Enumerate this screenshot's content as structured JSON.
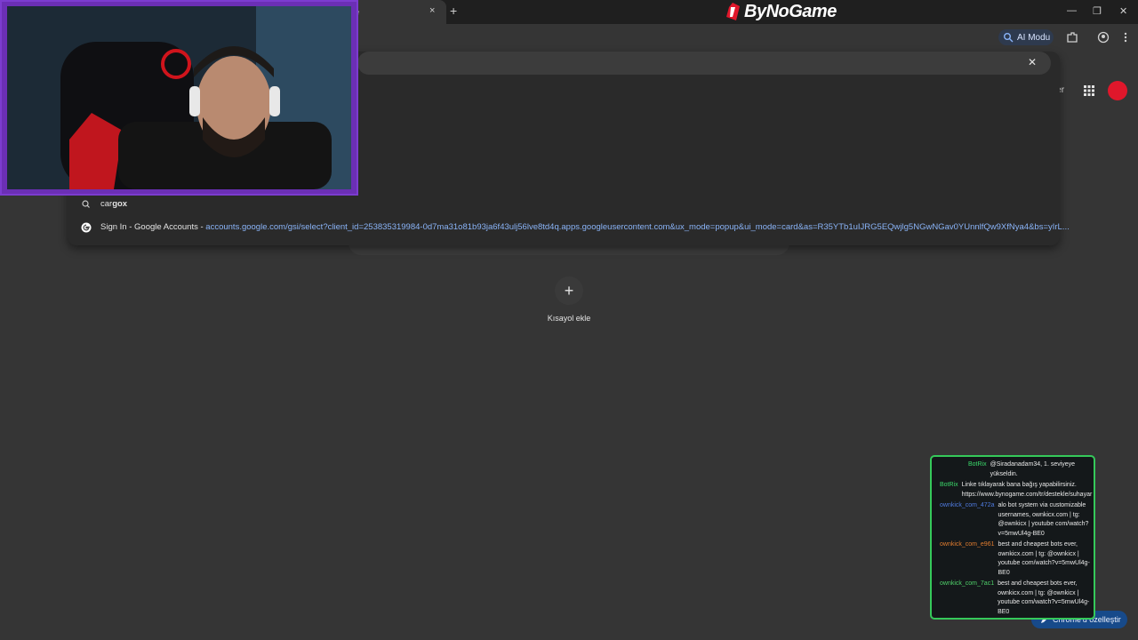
{
  "browser": {
    "tab_title": "e",
    "tab_close": "×",
    "new_tab": "+",
    "window_controls": {
      "minimize": "—",
      "maximize": "❐",
      "close": "✕"
    }
  },
  "overlay_brand": {
    "name": "ByNoGame",
    "color": "#e0172b"
  },
  "toolbar": {
    "ai_mode_label": "AI Modu",
    "ai_icon": "sparkle-search-icon"
  },
  "omnibox": {
    "clear": "✕",
    "suggestions": [
      {
        "icon": "search-icon",
        "prefix": "car",
        "bold": "gox",
        "text": "",
        "url": ""
      },
      {
        "icon": "google-icon",
        "prefix": "",
        "bold": "",
        "text": "Sign In - Google Accounts",
        "url": "accounts.google.com/gsi/select?client_id=253835319984-0d7ma31o81b93ja6f43ulj56lve8td4q.apps.googleusercontent.com&ux_mode=popup&ui_mode=card&as=R35YTb1uIJRG5EQwjlg5NGwNGav0YUnnlfQw9XfNya4&bs=yIrL..."
      }
    ]
  },
  "header_right": {
    "partial_label": "ler"
  },
  "ntp": {
    "shortcut_add_symbol": "+",
    "shortcut_add_label": "Kısayol ekle",
    "customize_label": "Chrome'u özelleştir"
  },
  "chat": {
    "messages": [
      {
        "user": "BotRix",
        "user_color": "#3bd96b",
        "text": "@Siradanadam34, 1. seviyeye yükseldin."
      },
      {
        "user": "BotRix",
        "user_color": "#3bd96b",
        "text": "Linke tıklayarak bana bağış yapabilirsiniz. https://www.bynogame.com/tr/destekle/suhayar"
      },
      {
        "user": "ownkick_com_472a",
        "user_color": "#4f7be0",
        "text": "alo bot system via customizable usernames, ownkicx.com | tg: @ownkicx | youtube com/watch?v=5mwUl4g-BE0"
      },
      {
        "user": "ownkick_com_e961",
        "user_color": "#e07c2f",
        "text": "best and cheapest bots ever, ownkicx.com | tg: @ownkicx | youtube com/watch?v=5mwUl4g-BE0"
      },
      {
        "user": "ownkick_com_7ac1",
        "user_color": "#4fd06a",
        "text": "best and cheapest bots ever, ownkicx.com | tg: @ownkicx | youtube com/watch?v=5mwUl4g-BE0"
      }
    ]
  }
}
